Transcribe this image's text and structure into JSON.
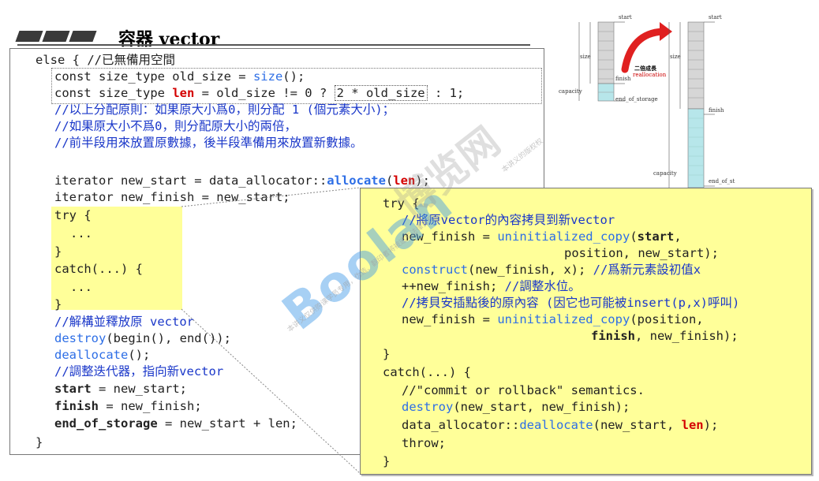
{
  "title": "容器 vector",
  "main_code": {
    "l1": "else { //已無備用空間",
    "l2a": "const size_type old_size = ",
    "l2b": "size",
    "l2c": "();",
    "l3a": "const size_type ",
    "l3b": "len",
    "l3c": " = old_size != 0 ? ",
    "l3d": "2 * old_size",
    "l3e": " : 1;",
    "l4": "//以上分配原則：如果原大小爲0，則分配 1 (個元素大小)；",
    "l5": "//如果原大小不爲0，則分配原大小的兩倍，",
    "l6": "//前半段用來放置原數據，後半段準備用來放置新數據。",
    "l7a": "iterator new_start = data_allocator::",
    "l7b": "allocate",
    "l7c": "(",
    "l7d": "len",
    "l7e": ");",
    "l8": "iterator new_finish = new_start;",
    "l9": "try {",
    "l10": "...",
    "l11": "}",
    "l12": "catch(...) {",
    "l13": "...",
    "l14": "}",
    "l15": "//解構並釋放原 vector",
    "l16a": "destroy",
    "l16b": "(begin(), end());",
    "l17a": "deallocate",
    "l17b": "();",
    "l18": "//調整迭代器，指向新vector",
    "l19a": "start",
    "l19b": " = new_start;",
    "l20a": "finish",
    "l20b": " = new_finish;",
    "l21a": "end_of_storage",
    "l21b": " = new_start + len;",
    "l22": "}"
  },
  "popup_code": {
    "p1": "try {",
    "p2": "//將原vector的內容拷貝到新vector",
    "p3a": "new_finish = ",
    "p3b": "uninitialized_copy",
    "p3c": "(",
    "p3d": "start",
    "p3e": ",",
    "p4": "position, new_start);",
    "p5a": "construct",
    "p5b": "(new_finish, x); ",
    "p5c": "//爲新元素設初值x",
    "p6a": "++new_finish; ",
    "p6b": "//調整水位。",
    "p7": "//拷貝安插點後的原內容 (因它也可能被insert(p,x)呼叫)",
    "p8a": "new_finish = ",
    "p8b": "uninitialized_copy",
    "p8c": "(position,",
    "p9a": "finish",
    "p9b": ", new_finish);",
    "p10": "}",
    "p11": "catch(...) {",
    "p12": "//\"commit or rollback\" semantics.",
    "p13a": "destroy",
    "p13b": "(new_start, new_finish);",
    "p14a": "data_allocator::",
    "p14b": "deallocate",
    "p14c": "(new_start, ",
    "p14d": "len",
    "p14e": ");",
    "p15": "throw;",
    "p16": "}"
  },
  "diagram": {
    "start1": "start",
    "size1": "size",
    "finish1": "finish",
    "capacity1": "capacity",
    "eos1": "end_of_storage",
    "arrow_title": "二倍成長",
    "arrow_sub": "reallocation",
    "start2": "start",
    "size2": "size",
    "finish2": "finish",
    "capacity2": "capacity",
    "eos2": "end_of_st"
  },
  "watermark": {
    "brand": "Boolan",
    "cn": "博览网",
    "fine1": "本讲义仅供购课学员专用，伪造、翻印者将被追究法律责任",
    "fine2": "本讲义的版权权"
  },
  "colors": {
    "comment": "#1a37c9",
    "function": "#2d6ee6",
    "keyword_red": "#d40000",
    "popup_bg": "#ffff99",
    "diagram_teal": "#b7e6ea"
  }
}
